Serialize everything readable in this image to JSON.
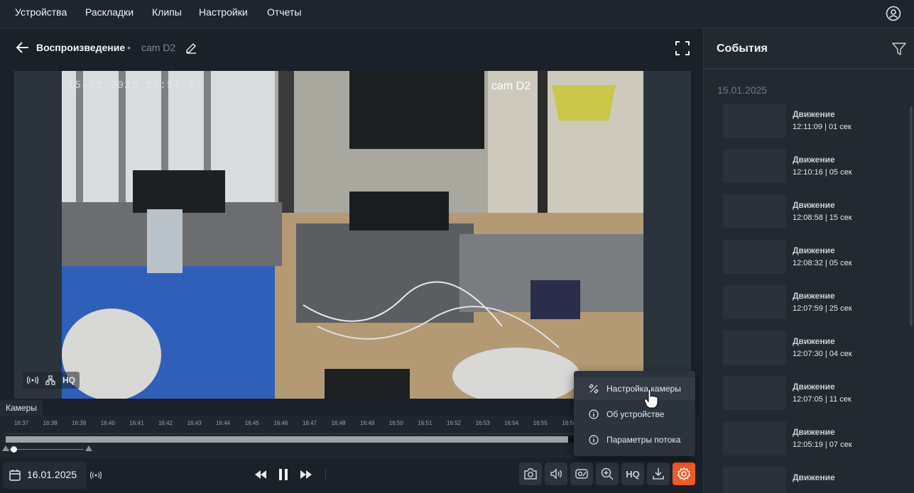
{
  "nav": {
    "items": [
      "Устройства",
      "Раскладки",
      "Клипы",
      "Настройки",
      "Отчеты"
    ]
  },
  "header": {
    "title": "Воспроизведение",
    "separator": "•",
    "camera": "cam D2"
  },
  "video": {
    "timestamp": "15-01-2025 14:57:27",
    "camera_overlay": "cam D2",
    "badge_hq": "HQ"
  },
  "timeline": {
    "tab": "Камеры",
    "ticks": [
      "16:37",
      "16:38",
      "16:39",
      "16:40",
      "16:41",
      "16:42",
      "16:43",
      "16:44",
      "16:45",
      "16:46",
      "16:47",
      "16:48",
      "16:49",
      "16:50",
      "16:51",
      "16:52",
      "16:53",
      "16:54",
      "16:55",
      "16:56"
    ]
  },
  "bottom": {
    "date": "16.01.2025",
    "hq_label": "HQ"
  },
  "menu": {
    "items": [
      {
        "label": "Настройка камеры",
        "icon": "camera-settings-icon"
      },
      {
        "label": "Об устройстве",
        "icon": "info-icon"
      },
      {
        "label": "Параметры потока",
        "icon": "info-icon"
      }
    ]
  },
  "events": {
    "title": "События",
    "date": "15.01.2025",
    "list": [
      {
        "type": "Движение",
        "time": "12:11:09 | 01 сек"
      },
      {
        "type": "Движение",
        "time": "12:10:16 | 05 сек"
      },
      {
        "type": "Движение",
        "time": "12:08:58 | 15 сек"
      },
      {
        "type": "Движение",
        "time": "12:08:32 | 05 сек"
      },
      {
        "type": "Движение",
        "time": "12:07:59 | 25 сек"
      },
      {
        "type": "Движение",
        "time": "12:07:30 | 04 сек"
      },
      {
        "type": "Движение",
        "time": "12:07:05 | 11 сек"
      },
      {
        "type": "Движение",
        "time": "12:05:19 | 07 сек"
      },
      {
        "type": "Движение",
        "time": ""
      }
    ]
  },
  "colors": {
    "accent": "#f05a28",
    "background": "#1b2129",
    "panel": "#222930"
  }
}
